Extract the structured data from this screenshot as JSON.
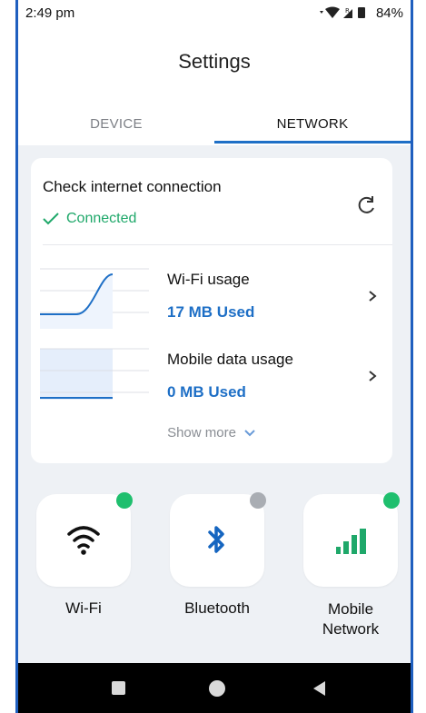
{
  "status_bar": {
    "time": "2:49 pm",
    "battery": "84%",
    "icons": [
      "signal-icon",
      "wifi-icon",
      "battery-icon"
    ]
  },
  "header": {
    "title": "Settings"
  },
  "tabs": [
    {
      "label": "DEVICE",
      "active": false
    },
    {
      "label": "NETWORK",
      "active": true
    }
  ],
  "connection_card": {
    "title": "Check internet connection",
    "status": "Connected",
    "status_color": "#1fa86a",
    "rows": [
      {
        "label": "Wi-Fi usage",
        "value": "17 MB Used"
      },
      {
        "label": "Mobile data usage",
        "value": "0 MB Used"
      }
    ],
    "show_more": "Show more"
  },
  "quick_tiles": [
    {
      "label": "Wi-Fi",
      "icon": "wifi-icon",
      "status_color": "#1fbf6e"
    },
    {
      "label": "Bluetooth",
      "icon": "bluetooth-icon",
      "status_color": "#a9adb3"
    },
    {
      "label": "Mobile",
      "label2": "Network",
      "icon": "cellular-signal-icon",
      "status_color": "#1fbf6e"
    }
  ],
  "colors": {
    "accent": "#1e6fc6",
    "background": "#eef1f5"
  }
}
